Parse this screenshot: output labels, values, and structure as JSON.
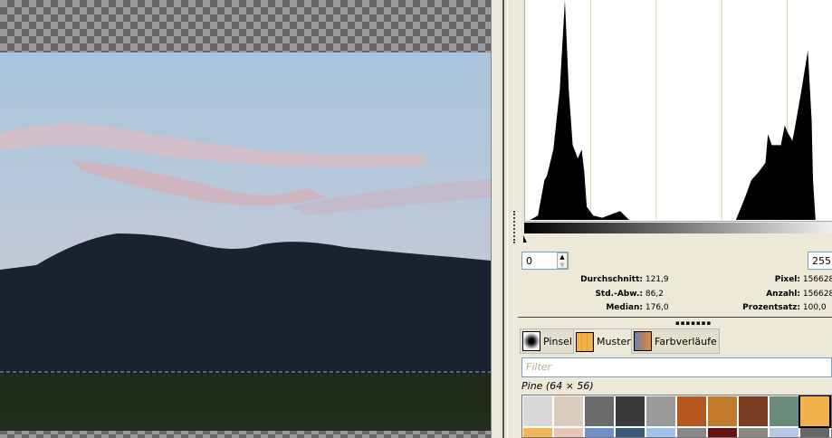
{
  "histogram": {
    "range_min": "0",
    "range_max": "255",
    "profile": [
      [
        4,
        0
      ],
      [
        10,
        0.02
      ],
      [
        15,
        0.18
      ],
      [
        17,
        0.2
      ],
      [
        22,
        0.32
      ],
      [
        27,
        0.59
      ],
      [
        31,
        1
      ],
      [
        34,
        0.59
      ],
      [
        37,
        0.34
      ],
      [
        41,
        0.28
      ],
      [
        44,
        0.32
      ],
      [
        46,
        0.22
      ],
      [
        48,
        0.06
      ],
      [
        53,
        0.02
      ],
      [
        60,
        0.01
      ],
      [
        74,
        0.04
      ],
      [
        81,
        0
      ],
      [
        164,
        0
      ],
      [
        171,
        0.1
      ],
      [
        176,
        0.18
      ],
      [
        182,
        0.22
      ],
      [
        187,
        0.26
      ],
      [
        189,
        0.39
      ],
      [
        192,
        0.34
      ],
      [
        199,
        0.34
      ],
      [
        202,
        0.43
      ],
      [
        204,
        0.4
      ],
      [
        208,
        0.36
      ],
      [
        210,
        0.42
      ],
      [
        215,
        0.59
      ],
      [
        220,
        0.77
      ],
      [
        223,
        0.45
      ],
      [
        224,
        0.18
      ],
      [
        226,
        0
      ]
    ]
  },
  "stats": {
    "mean_label": "Durchschnitt:",
    "mean": "121,9",
    "std_label": "Std.-Abw.:",
    "std": "86,2",
    "median_label": "Median:",
    "median": "176,0",
    "pixels_label": "Pixel:",
    "pixels": "156628",
    "count_label": "Anzahl:",
    "count": "156628",
    "percent_label": "Prozentsatz:",
    "percent": "100,0"
  },
  "tabs": [
    {
      "label": "Pinsel"
    },
    {
      "label": "Muster"
    },
    {
      "label": "Farbverläufe"
    }
  ],
  "filter_placeholder": "Filter",
  "pattern_name": "Pine (64 × 56)",
  "patterns": [
    "#d8d8d8",
    "#d9cdbf",
    "#6a6a6a",
    "#3a3a3a",
    "#9a9a9a",
    "#b5571f",
    "#c07a2a",
    "#7a3c22",
    "#6a8a7a",
    "#f2b24c",
    "#f3b456",
    "#e8c3b8",
    "#6e8fc8",
    "#3b5a7a",
    "#9fc3ea",
    "#888",
    "#6a1010",
    "#8a8a80",
    "#b8c8e8",
    "#666"
  ],
  "colors": {
    "panel": "#ece9d8",
    "accent": "#7f9db9"
  }
}
